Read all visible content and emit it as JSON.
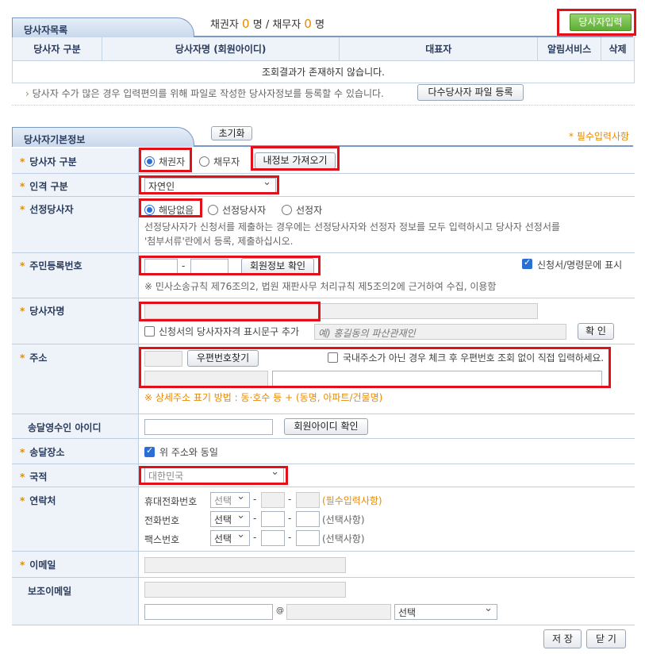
{
  "list_section": {
    "title": "당사자목록",
    "creditor_label": "채권자",
    "creditor_count": "0",
    "debtor_label": "/ 채무자",
    "debtor_count": "0",
    "unit": "명",
    "unit2": "명",
    "input_button": "당사자입력",
    "columns": [
      "당사자 구분",
      "당사자명 (회원아이디)",
      "대표자",
      "알림서비스",
      "삭제"
    ],
    "empty_message": "조회결과가 존재하지 않습니다.",
    "bulk_note": "당사자 수가 많은 경우 입력편의를 위해 파일로 작성한 당사자정보를 등록할 수 있습니다.",
    "bulk_button": "다수당사자 파일 등록"
  },
  "form_section": {
    "title": "당사자기본정보",
    "reset_button": "초기화",
    "required_note": "* 필수입력사항",
    "party_type": {
      "label": "당사자 구분",
      "option_creditor": "채권자",
      "option_debtor": "채무자",
      "load_button": "내정보 가져오기",
      "selected": "채권자"
    },
    "person_type": {
      "label": "인격 구분",
      "value": "자연인"
    },
    "designated": {
      "label": "선정당사자",
      "option_none": "해당없음",
      "option_designated": "선정당사자",
      "option_selector": "선정자",
      "help_line1": "선정당사자가 신청서를 제출하는 경우에는 선정당사자와 선정자 정보를 모두 입력하시고 당사자 선정서를",
      "help_line2": "'첨부서류'란에서 등록, 제출하십시오."
    },
    "resident_no": {
      "label": "주민등록번호",
      "dash": "-",
      "verify_button": "회원정보 확인",
      "show_label": "신청서/명령문에 표시",
      "note": "※ 민사소송규칙 제76조의2, 법원 재판사무 처리규칙 제5조의2에 근거하여 수집, 이용함"
    },
    "party_name": {
      "label": "당사자명",
      "qualifier_label": "신청서의 당사자자격 표시문구 추가",
      "qualifier_placeholder": "예) 홍길동의 파산관재인",
      "confirm_button": "확 인"
    },
    "address": {
      "label": "주소",
      "zip_button": "우편번호찾기",
      "foreign_label": "국내주소가 아닌 경우 체크 후 우편번호 조회 없이 직접 입력하세요.",
      "detail_note": "※ 상세주소 표기 방법 : 동·호수 등 + (동명, 아파트/건물명)"
    },
    "receiver_id": {
      "label": "송달영수인 아이디",
      "verify_button": "회원아이디 확인"
    },
    "delivery_place": {
      "label": "송달장소",
      "same_label": "위 주소와 동일"
    },
    "nationality": {
      "label": "국적",
      "value": "대한민국"
    },
    "contact": {
      "label": "연락처",
      "mobile_label": "휴대전화번호",
      "phone_label": "전화번호",
      "fax_label": "팩스번호",
      "select_value": "선택",
      "dash": "-",
      "mobile_note": "(필수입력사항)",
      "phone_note": "(선택사항)",
      "fax_note": "(선택사항)"
    },
    "email": {
      "label": "이메일"
    },
    "sub_email": {
      "label": "보조이메일",
      "at": "@",
      "domain_select": "선택"
    },
    "save_button": "저 장",
    "close_button": "닫 기"
  }
}
